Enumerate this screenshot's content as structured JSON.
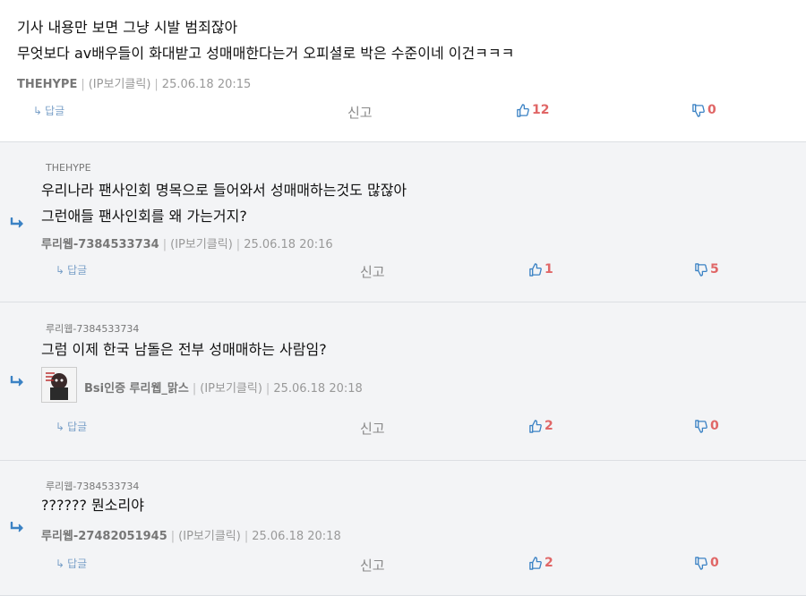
{
  "comments": [
    {
      "lines": [
        "기사 내용만 보면 그냥 시발 범죄잖아",
        "무엇보다 av배우들이 화대받고 성매매한다는거 오피셜로 박은 수준이네 이건ㅋㅋㅋ"
      ],
      "author": "THEHYPE",
      "ip": "(IP보기클릭)",
      "date": "25.06.18 20:15",
      "reply_label": "답글",
      "report_label": "신고",
      "up": "12",
      "down": "0"
    },
    {
      "parent": "THEHYPE",
      "lines": [
        "우리나라 팬사인회 명목으로 들어와서 성매매하는것도 많잖아",
        "그런애들 팬사인회를 왜 가는거지?"
      ],
      "author": "루리웹-7384533734",
      "ip": "(IP보기클릭)",
      "date": "25.06.18 20:16",
      "reply_label": "답글",
      "report_label": "신고",
      "up": "1",
      "down": "5"
    },
    {
      "parent": "루리웹-7384533734",
      "lines": [
        "그럼 이제 한국 남돌은 전부 성매매하는 사람임?"
      ],
      "author": "Bsi인증 루리웹_맑스",
      "ip": "(IP보기클릭)",
      "date": "25.06.18 20:18",
      "reply_label": "답글",
      "report_label": "신고",
      "up": "2",
      "down": "0"
    },
    {
      "parent": "루리웹-7384533734",
      "lines": [
        "?????? 뭔소리야"
      ],
      "author": "루리웹-27482051945",
      "ip": "(IP보기클릭)",
      "date": "25.06.18 20:18",
      "reply_label": "답글",
      "report_label": "신고",
      "up": "2",
      "down": "0"
    }
  ],
  "colors": {
    "vote": "#e06666",
    "accent": "#3b82c4",
    "reply_bg": "#f3f4f6"
  },
  "icons": {
    "reply": "reply-arrow-icon",
    "up": "thumbs-up-icon",
    "down": "thumbs-down-icon"
  }
}
